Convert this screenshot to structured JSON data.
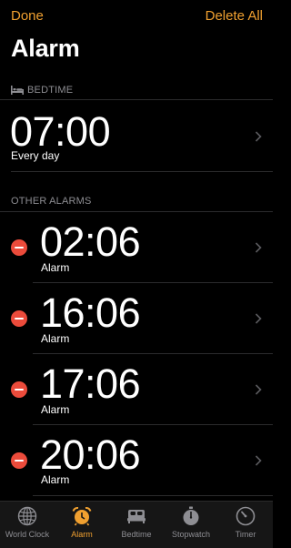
{
  "navbar": {
    "done_label": "Done",
    "delete_all_label": "Delete All"
  },
  "page": {
    "title": "Alarm"
  },
  "bedtime": {
    "header": "BEDTIME",
    "time": "07:00",
    "label": "Every day"
  },
  "other_alarms": {
    "header": "OTHER ALARMS",
    "items": [
      {
        "time": "02:06",
        "label": "Alarm"
      },
      {
        "time": "16:06",
        "label": "Alarm"
      },
      {
        "time": "17:06",
        "label": "Alarm"
      },
      {
        "time": "20:06",
        "label": "Alarm"
      }
    ]
  },
  "tabbar": {
    "items": [
      {
        "label": "World Clock",
        "icon": "globe-icon",
        "active": false
      },
      {
        "label": "Alarm",
        "icon": "alarm-clock-icon",
        "active": true
      },
      {
        "label": "Bedtime",
        "icon": "bed-icon",
        "active": false
      },
      {
        "label": "Stopwatch",
        "icon": "stopwatch-icon",
        "active": false
      },
      {
        "label": "Timer",
        "icon": "timer-icon",
        "active": false
      }
    ]
  },
  "colors": {
    "accent": "#f0a030",
    "delete": "#eb4b3b",
    "background": "#000000"
  }
}
